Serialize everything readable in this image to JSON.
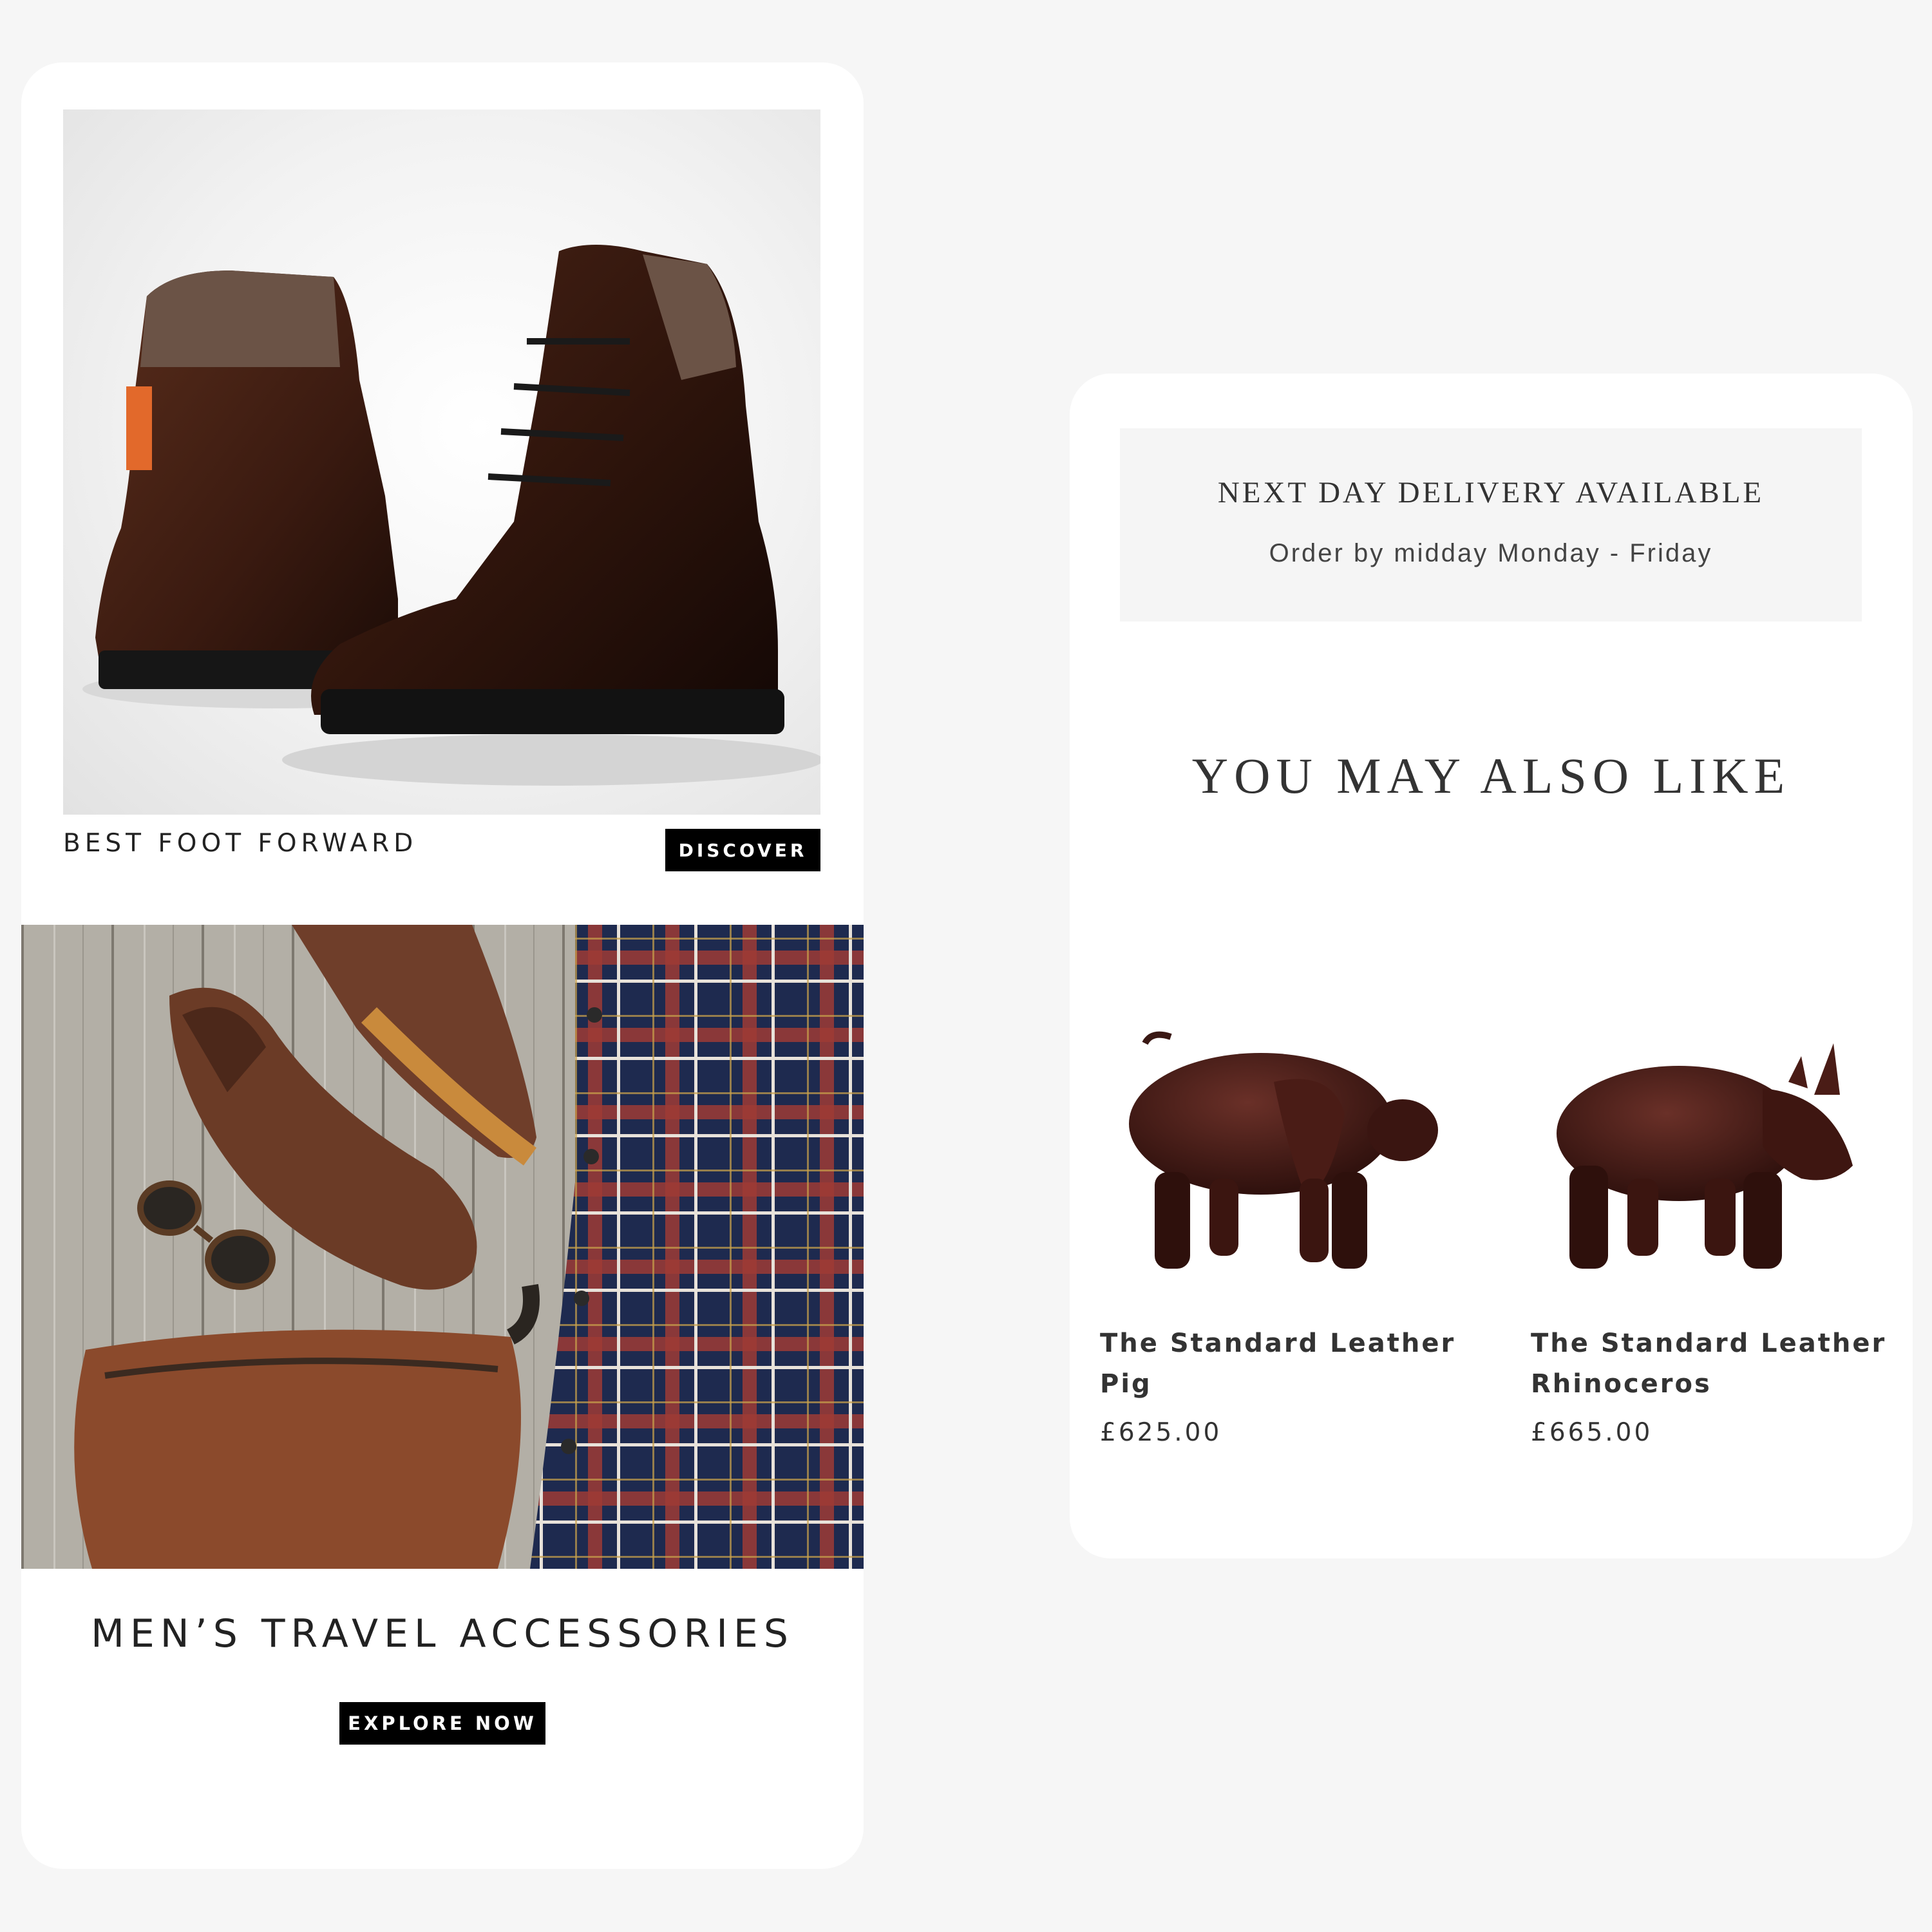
{
  "hero": {
    "caption": "BEST FOOT FORWARD",
    "button_label": "DISCOVER"
  },
  "collection": {
    "title": "MEN’S TRAVEL ACCESSORIES",
    "button_label": "EXPLORE NOW"
  },
  "delivery": {
    "title": "NEXT DAY DELIVERY AVAILABLE",
    "subtitle": "Order by midday Monday - Friday"
  },
  "recommendations": {
    "heading": "YOU MAY ALSO LIKE",
    "products": [
      {
        "name": "The Standard Leather Pig",
        "price": "£625.00",
        "icon": "leather-pig-image"
      },
      {
        "name": "The Standard Leather Rhinoceros",
        "price": "£665.00",
        "icon": "leather-rhinoceros-image"
      }
    ]
  },
  "colors": {
    "page_background": "#f6f6f6",
    "card_background": "#ffffff",
    "button_background": "#000000",
    "button_text": "#ffffff",
    "delivery_box": "#f5f5f5"
  }
}
